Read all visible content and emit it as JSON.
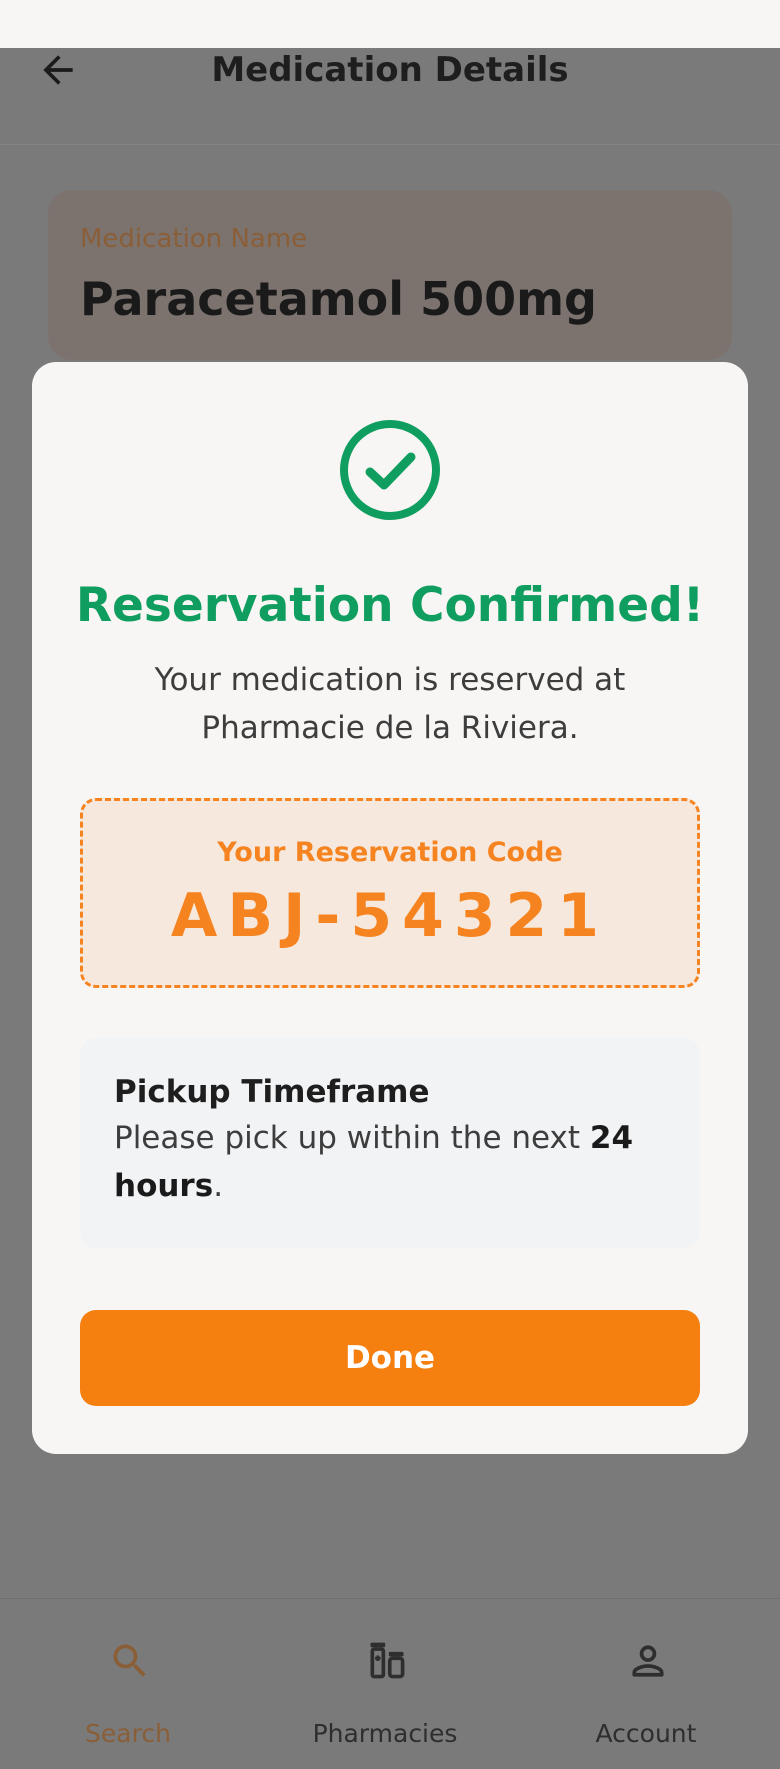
{
  "header": {
    "title": "Medication Details"
  },
  "medication": {
    "label": "Medication Name",
    "name": "Paracetamol 500mg"
  },
  "modal": {
    "title": "Reservation Confirmed!",
    "message": "Your medication is reserved at Pharmacie de la Riviera.",
    "code_label": "Your Reservation Code",
    "code": "ABJ-54321",
    "pickup_title": "Pickup Timeframe",
    "pickup_text_prefix": "Please pick up within the next ",
    "pickup_text_bold": "24 hours",
    "pickup_text_suffix": ".",
    "done_label": "Done"
  },
  "nav": {
    "items": [
      {
        "label": "Search",
        "icon": "search-icon",
        "active": true
      },
      {
        "label": "Pharmacies",
        "icon": "medication-icon",
        "active": false
      },
      {
        "label": "Account",
        "icon": "person-icon",
        "active": false
      }
    ]
  },
  "colors": {
    "accent": "#f5831f",
    "success": "#0f9e5f",
    "nav_active": "#8a5e37",
    "nav_inactive": "#2e2e2e"
  }
}
